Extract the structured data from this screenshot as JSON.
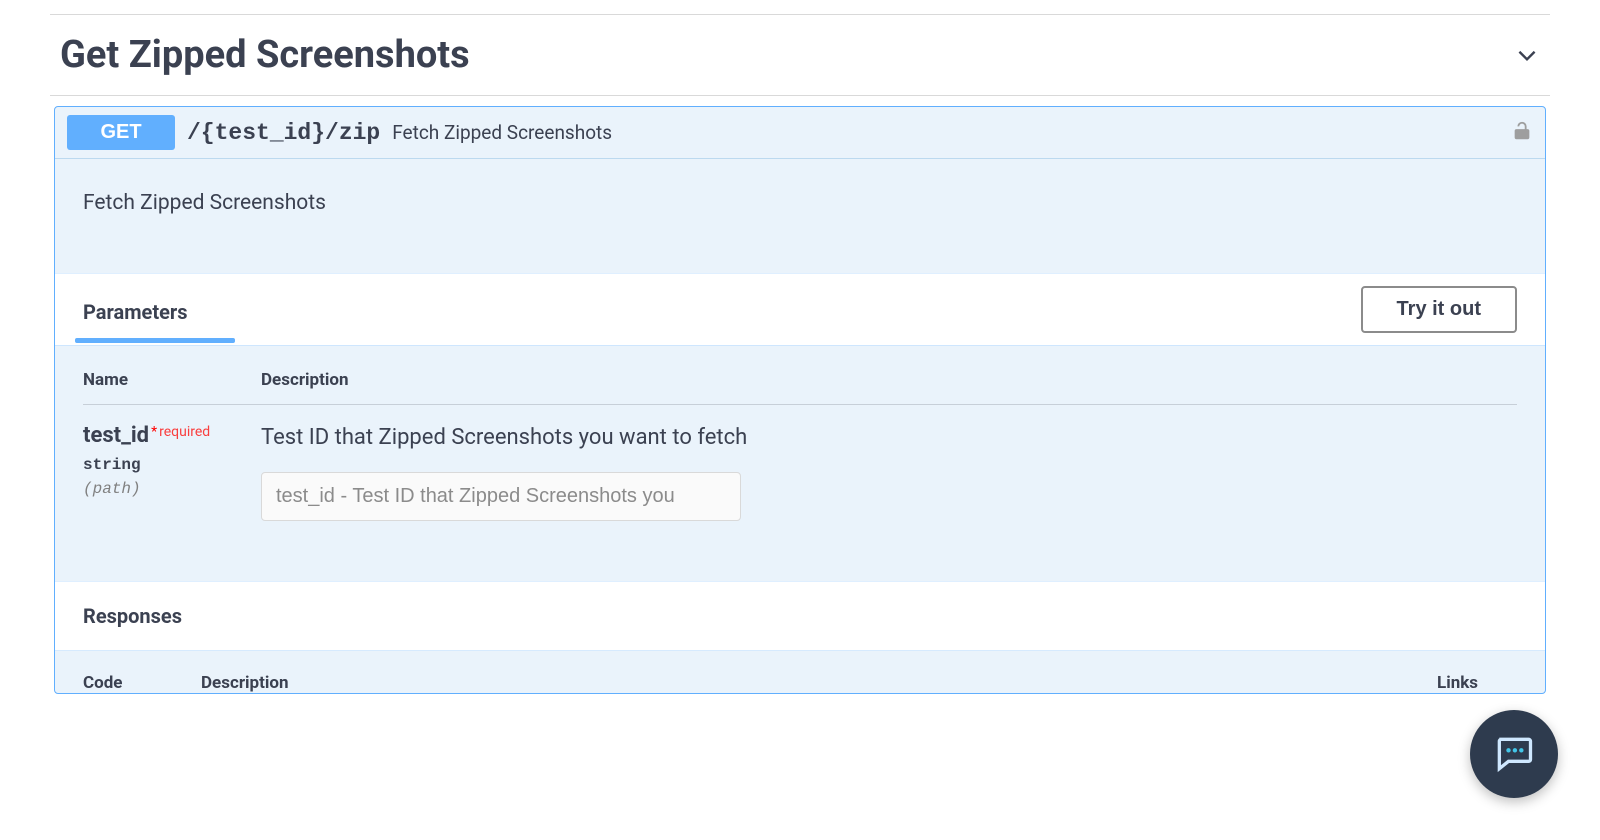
{
  "section": {
    "title": "Get Zipped Screenshots"
  },
  "operation": {
    "method": "GET",
    "path": "/{test_id}/zip",
    "summary": "Fetch Zipped Screenshots",
    "description": "Fetch Zipped Screenshots"
  },
  "tabs": {
    "parameters": "Parameters",
    "try_it_out": "Try it out"
  },
  "param_headers": {
    "name": "Name",
    "description": "Description"
  },
  "parameter": {
    "name": "test_id",
    "required_label": "required",
    "type": "string",
    "in": "(path)",
    "description": "Test ID that Zipped Screenshots you want to fetch",
    "placeholder": "test_id - Test ID that Zipped Screenshots you"
  },
  "responses": {
    "label": "Responses",
    "headers": {
      "code": "Code",
      "description": "Description",
      "links": "Links"
    }
  }
}
